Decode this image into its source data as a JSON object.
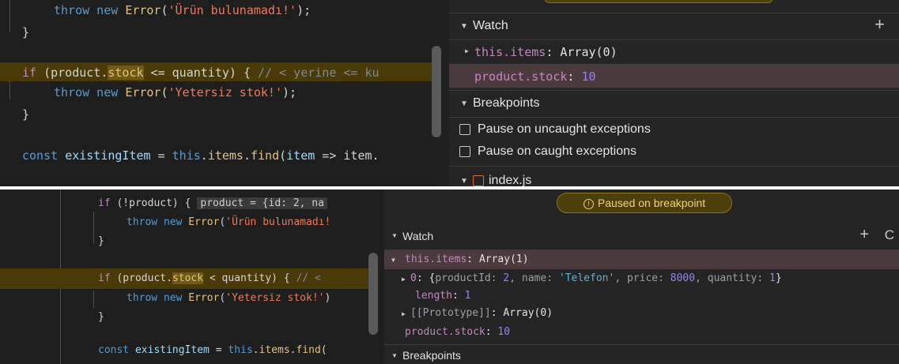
{
  "top": {
    "code": {
      "l1": {
        "kw": "throw new ",
        "cls": "Error",
        "open": "(",
        "str": "'Ürün bulunamadı!'",
        "close": ");"
      },
      "l2": "}",
      "l3": {
        "kw": "if",
        "p1": " (product.",
        "stock": "stock",
        "p2": " <= quantity) { ",
        "comment": "// < yerine <= ku"
      },
      "l4": {
        "kw": "throw new ",
        "cls": "Error",
        "open": "(",
        "str": "'Yetersiz stok!'",
        "close": ");"
      },
      "l5": "}",
      "l6": {
        "kw": "const ",
        "var": "existingItem",
        "eq": " = ",
        "this": "this",
        "dot1": ".",
        "items": "items",
        "dot2": ".",
        "find": "find",
        "p1": "(",
        "item": "item",
        "arrow": " => ",
        "rest": "item."
      }
    },
    "watch": {
      "title": "Watch",
      "add": "+",
      "items_key": "this.items",
      "items_val": "Array(0)",
      "stock_key": "product.stock",
      "stock_val": "10"
    },
    "breakpoints": {
      "title": "Breakpoints",
      "options": [
        "Pause on uncaught exceptions",
        "Pause on caught exceptions"
      ]
    },
    "file": "index.js"
  },
  "bottom": {
    "banner": "Paused on breakpoint",
    "code": {
      "l1": {
        "kw": "if",
        "p1": " (!product) {",
        "inline": "product = {id: 2, na"
      },
      "l2": {
        "kw": "throw new ",
        "cls": "Error",
        "open": "(",
        "str": "'Ürün bulunamadı!"
      },
      "l3": "}",
      "l4": {
        "kw": "if",
        "p1": " (product.",
        "stock": "stock",
        "p2": " < quantity) { ",
        "comment": "// <"
      },
      "l5": {
        "kw": "throw new ",
        "cls": "Error",
        "open": "(",
        "str": "'Yetersiz stok!'",
        "close": ")"
      },
      "l6": "}",
      "l7": {
        "kw": "const ",
        "var": "existingItem",
        "eq": " = ",
        "this": "this",
        "dot1": ".",
        "items": "items",
        "dot2": ".",
        "find": "find",
        "p1": "("
      }
    },
    "watch": {
      "title": "Watch",
      "add": "+",
      "refresh": "C",
      "items_key": "this.items",
      "items_val": "Array(1)",
      "child0": {
        "idx": "0",
        "open": "{",
        "k1": "productId",
        "v1": "2",
        "k2": "name",
        "v2": "'Telefon'",
        "k3": "price",
        "v3": "8000",
        "k4": "quantity",
        "v4": "1",
        "close": "}"
      },
      "length_key": "length",
      "length_val": "1",
      "proto_key": "[[Prototype]]",
      "proto_val": "Array(0)",
      "stock_key": "product.stock",
      "stock_val": "10"
    },
    "breakpoints": {
      "title": "Breakpoints"
    }
  },
  "colors": {
    "accent_line": "#4a3a08",
    "banner_bg": "#4d3f0b",
    "banner_border": "#8a7415",
    "watch_hl": "#4b3a3e"
  }
}
